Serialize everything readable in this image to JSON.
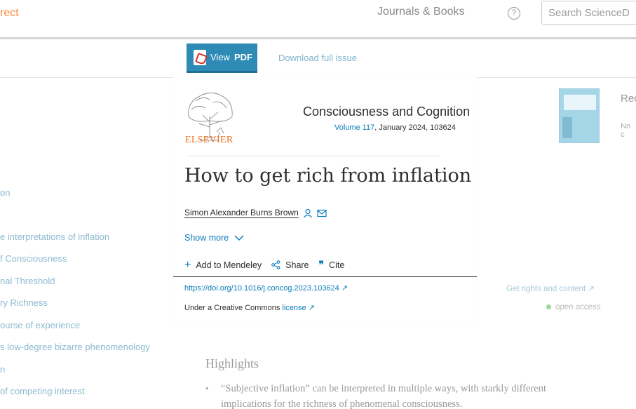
{
  "topbar": {
    "brand": "rect",
    "nav_journals": "Journals & Books",
    "help": "?",
    "search_placeholder": "Search ScienceD"
  },
  "toolbar": {
    "view_pdf_1": "View",
    "view_pdf_2": "PDF",
    "download": "Download full issue"
  },
  "outline": {
    "items": [
      "on",
      "e interpretations of inflation",
      "f Consciousness",
      "nal Threshold",
      "ry Richness",
      "ourse of experience",
      "s low-degree bizarre phenomenology",
      "n",
      " of competing interest"
    ]
  },
  "article": {
    "publisher": "ELSEVIER",
    "journal": "Consciousness and Cognition",
    "volume_link": "Volume 117",
    "volume_rest": ", January 2024, 103624",
    "title": "How to get rich from inflation",
    "author": "Simon Alexander Burns Brown",
    "show_more": "Show more",
    "actions": {
      "mendeley": "Add to Mendeley",
      "share": "Share",
      "cite": "Cite"
    },
    "doi": "https://doi.org/10.1016/j.concog.2023.103624",
    "license_prefix": "Under a Creative Commons ",
    "license_link": "license"
  },
  "sidebar_right": {
    "rec_title": "Rec",
    "rec_sub": "No c",
    "rights": "Get rights and content",
    "open_access": "open access"
  },
  "highlights": {
    "title": "Highlights",
    "items": [
      "“Subjective inflation” can be interpreted in multiple ways, with starkly different implications for the richness of phenomenal consciousness."
    ]
  }
}
